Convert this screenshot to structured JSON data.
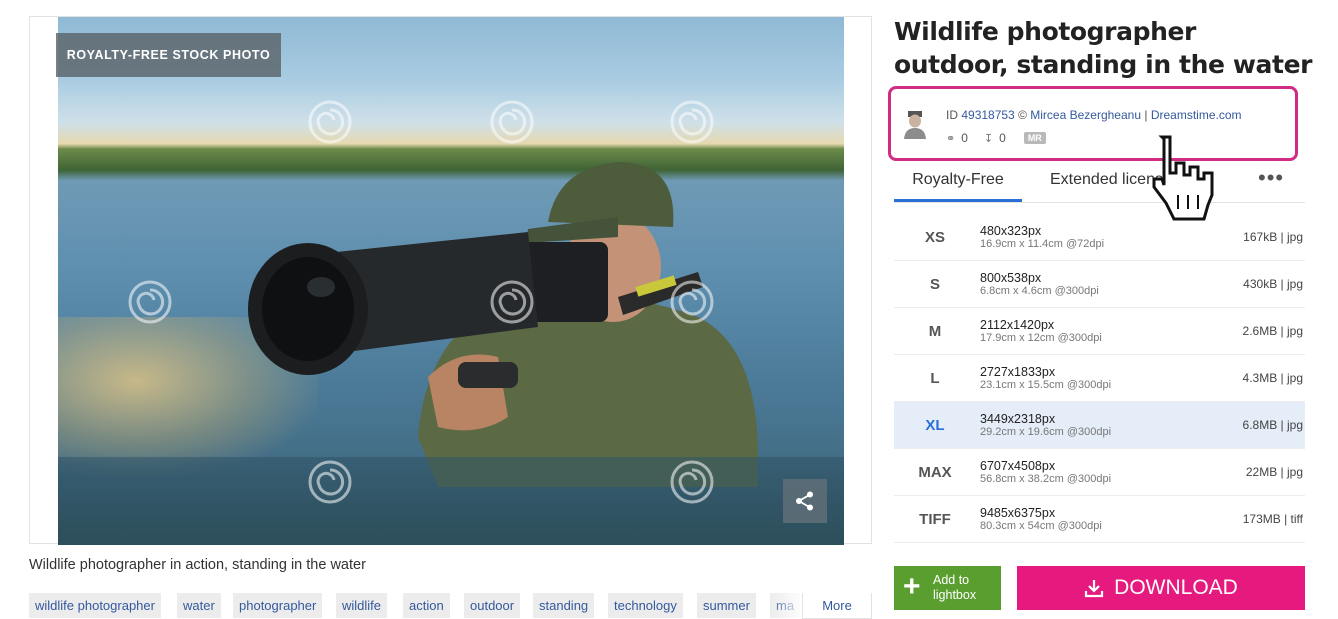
{
  "image": {
    "badge": "ROYALTY-FREE STOCK PHOTO",
    "watermark_icon": "dreamstime-spiral-icon",
    "share_icon": "share-icon"
  },
  "caption": "Wildlife photographer in action, standing in the water",
  "tags": [
    "wildlife photographer",
    "water",
    "photographer",
    "wildlife",
    "action",
    "outdoor",
    "standing",
    "technology",
    "summer",
    "ma"
  ],
  "tags_more_label": "More",
  "title": "Wildlife photographer outdoor, standing in the water",
  "author": {
    "id_prefix": "ID",
    "id": "49318753",
    "copyright": "©",
    "name": "Mircea Bezergheanu",
    "separator": "|",
    "site": "Dreamstime.com",
    "views": "0",
    "downloads": "0",
    "mr_badge": "MR",
    "highlight_color": "#d02c84"
  },
  "tabs": {
    "royalty_free": "Royalty-Free",
    "extended": "Extended licenses",
    "more": "•••"
  },
  "sizes": [
    {
      "code": "XS",
      "px": "480x323px",
      "cm": "16.9cm x 11.4cm @72dpi",
      "file": "167kB | jpg",
      "selected": false
    },
    {
      "code": "S",
      "px": "800x538px",
      "cm": "6.8cm x 4.6cm @300dpi",
      "file": "430kB | jpg",
      "selected": false
    },
    {
      "code": "M",
      "px": "2112x1420px",
      "cm": "17.9cm x 12cm @300dpi",
      "file": "2.6MB | jpg",
      "selected": false
    },
    {
      "code": "L",
      "px": "2727x1833px",
      "cm": "23.1cm x 15.5cm @300dpi",
      "file": "4.3MB | jpg",
      "selected": false
    },
    {
      "code": "XL",
      "px": "3449x2318px",
      "cm": "29.2cm x 19.6cm @300dpi",
      "file": "6.8MB | jpg",
      "selected": true
    },
    {
      "code": "MAX",
      "px": "6707x4508px",
      "cm": "56.8cm x 38.2cm @300dpi",
      "file": "22MB | jpg",
      "selected": false
    },
    {
      "code": "TIFF",
      "px": "9485x6375px",
      "cm": "80.3cm x 54cm @300dpi",
      "file": "173MB | tiff",
      "selected": false
    }
  ],
  "buttons": {
    "lightbox_line1": "Add to",
    "lightbox_line2": "lightbox",
    "download": "DOWNLOAD"
  },
  "colors": {
    "accent_blue": "#2a6fd6",
    "link_blue": "#34599e",
    "download_pink": "#e6197e",
    "lightbox_green": "#5a9e2f"
  }
}
